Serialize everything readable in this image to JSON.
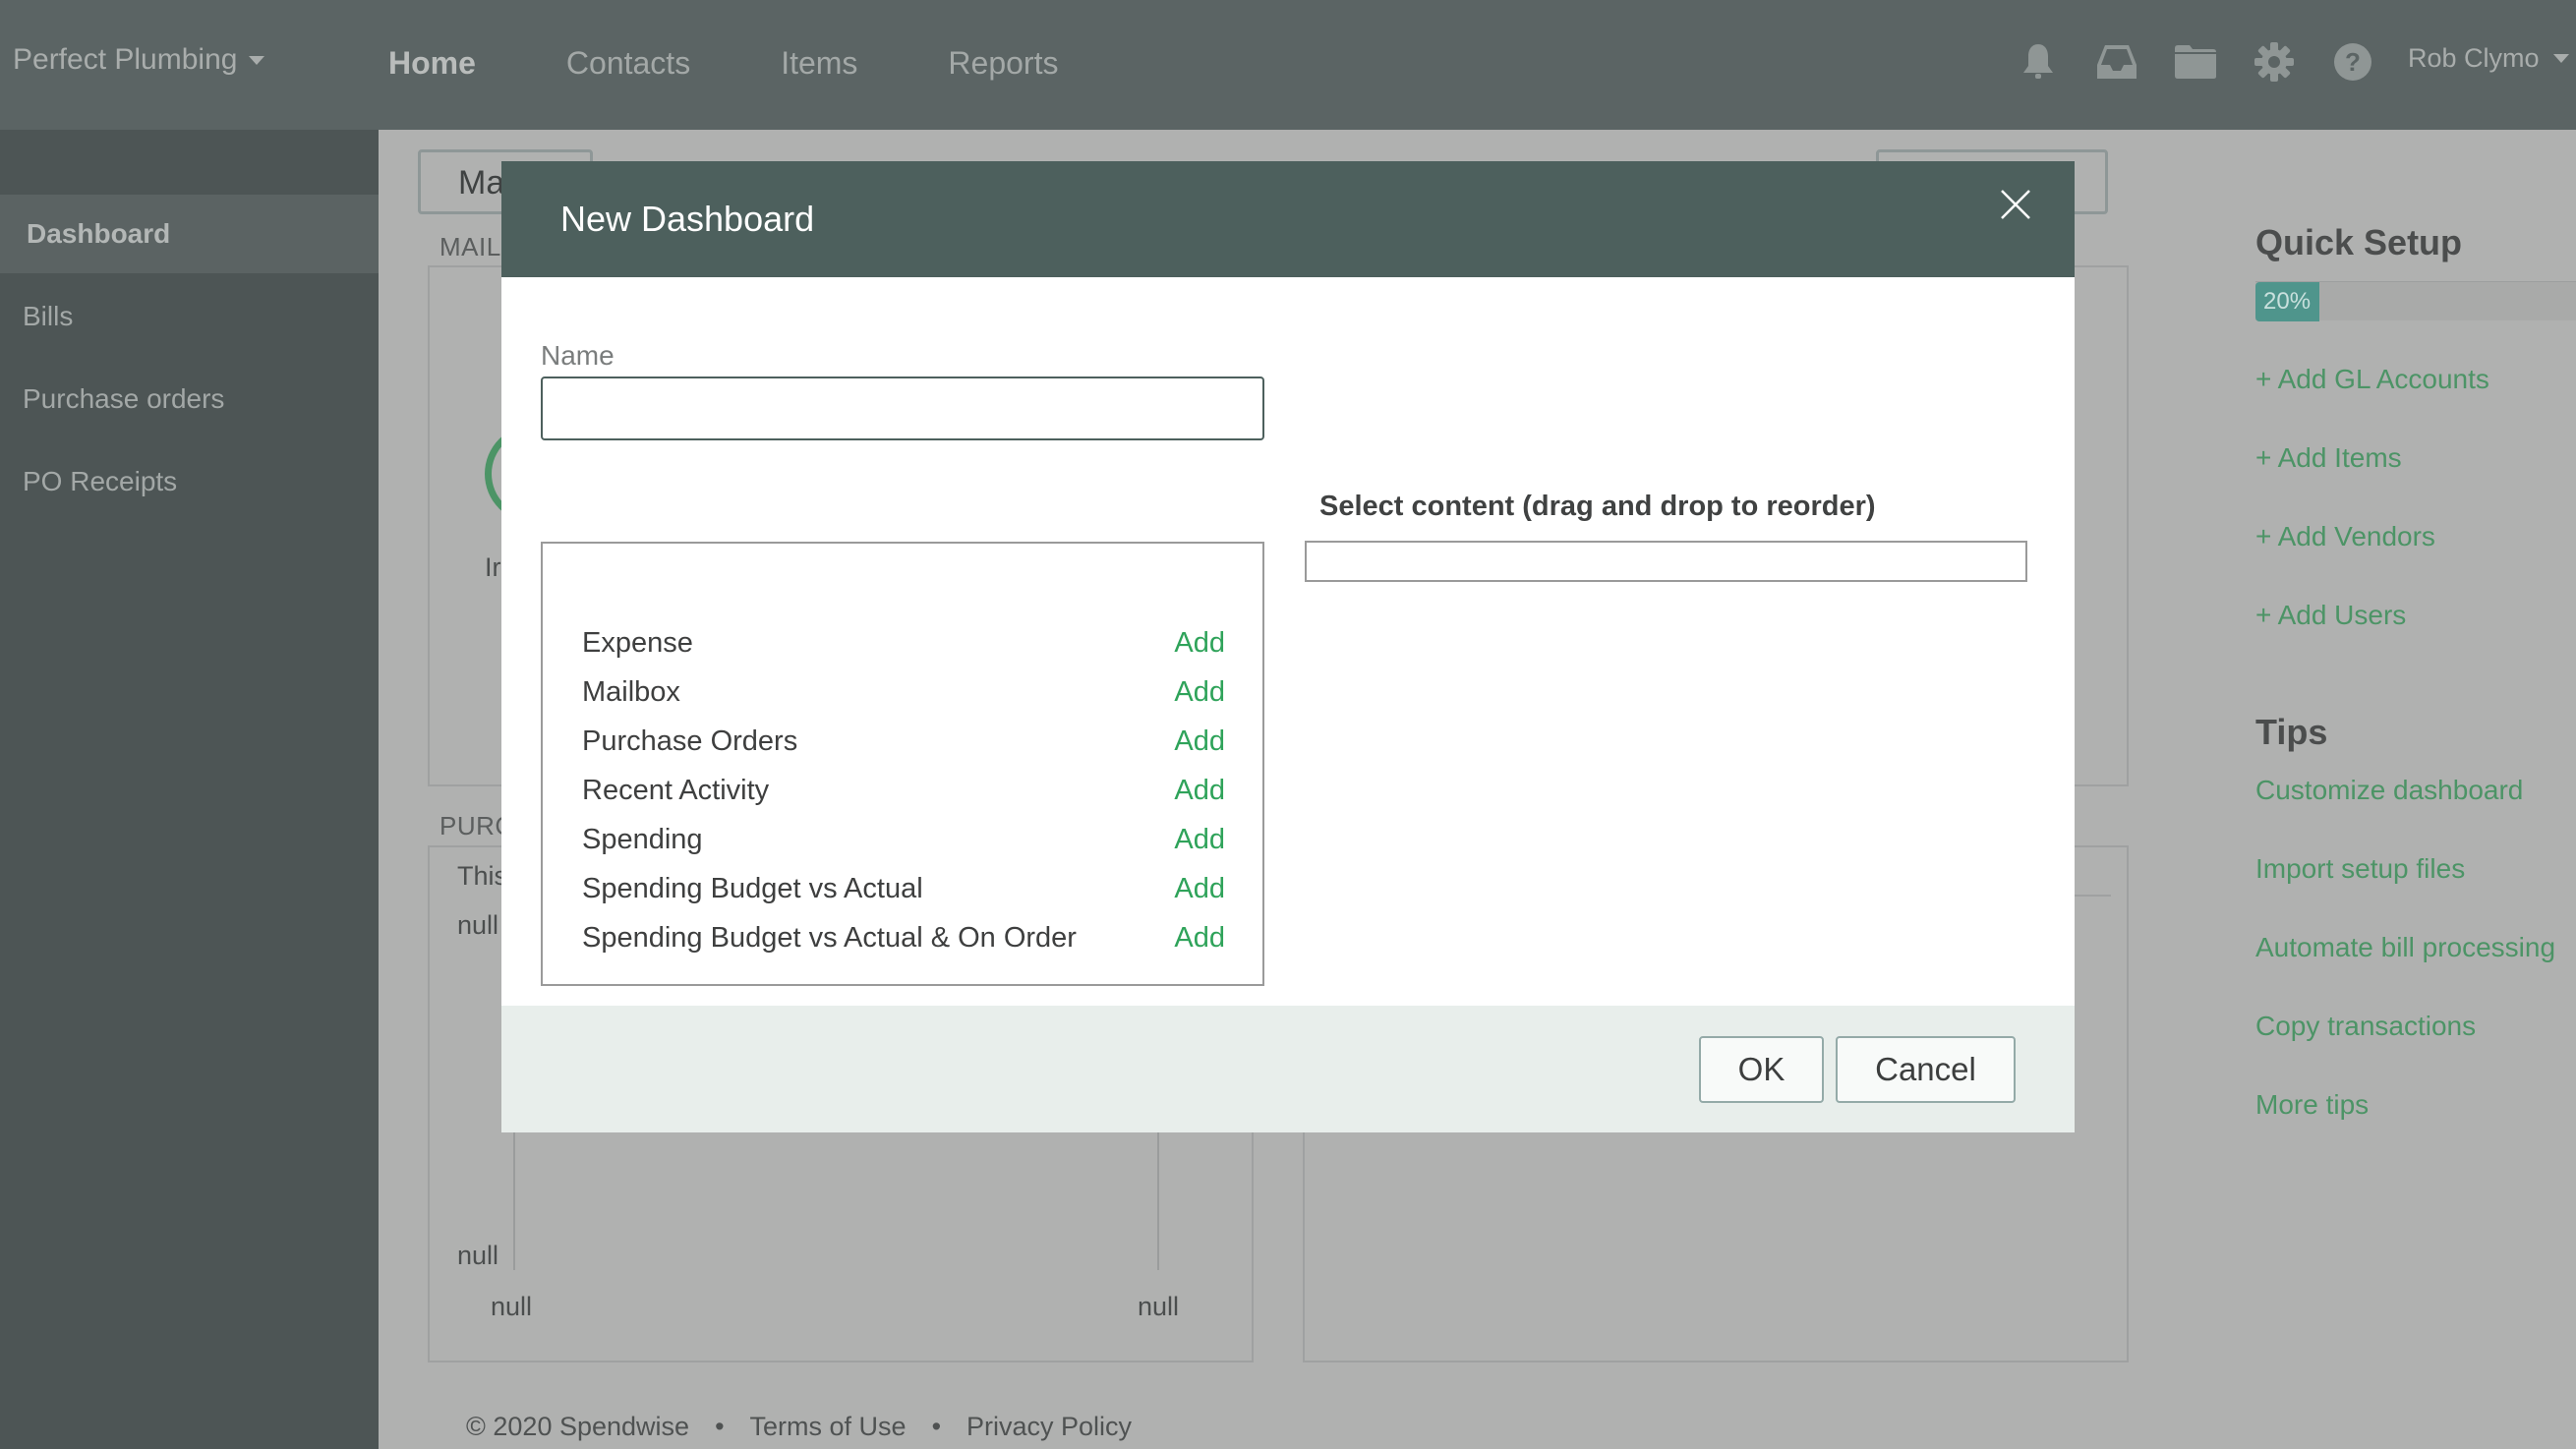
{
  "topbar": {
    "org_name": "Perfect Plumbing",
    "nav": [
      "Home",
      "Contacts",
      "Items",
      "Reports"
    ],
    "active_nav": "Home",
    "icons": [
      "bell-icon",
      "inbox-icon",
      "folder-icon",
      "gear-icon",
      "help-icon"
    ],
    "user_name": "Rob Clymo"
  },
  "sidebar": {
    "items": [
      {
        "label": "Dashboard",
        "active": true
      },
      {
        "label": "Bills"
      },
      {
        "label": "Purchase orders"
      },
      {
        "label": "PO Receipts"
      }
    ]
  },
  "background": {
    "dashboard_button": "Ma",
    "mailbox_label": "MAIL",
    "mailbox_sub": "Ir",
    "purchase_label": "PURC",
    "purchase_sub": "This",
    "chart_labels": {
      "y_top": "null",
      "y_bottom": "null",
      "x_left": "null",
      "x_right": "null"
    }
  },
  "footer": {
    "copyright": "© 2020 Spendwise",
    "sep": "•",
    "terms": "Terms of Use",
    "privacy": "Privacy Policy"
  },
  "quick_setup": {
    "title": "Quick Setup",
    "progress_percent": 20,
    "progress_label": "20%",
    "links": [
      "+ Add GL Accounts",
      "+ Add Items",
      "+ Add Vendors",
      "+ Add Users"
    ]
  },
  "tips": {
    "title": "Tips",
    "links": [
      "Customize dashboard",
      "Import setup files",
      "Automate bill processing",
      "Copy transactions",
      "More tips"
    ]
  },
  "modal": {
    "title": "New Dashboard",
    "name_label": "Name",
    "name_value": "",
    "select_label": "Select content (drag and drop to reorder)",
    "add_label": "Add",
    "available_items": [
      "Expense",
      "Mailbox",
      "Purchase Orders",
      "Recent Activity",
      "Spending",
      "Spending Budget vs Actual",
      "Spending Budget vs Actual & On Order"
    ],
    "selected_items": [],
    "ok_label": "OK",
    "cancel_label": "Cancel"
  },
  "colors": {
    "topbar": "#5b6464",
    "sidebar": "#4d5555",
    "modal_header": "#4d605d",
    "accent_green": "#2fa35a",
    "progress": "#4f958c"
  }
}
